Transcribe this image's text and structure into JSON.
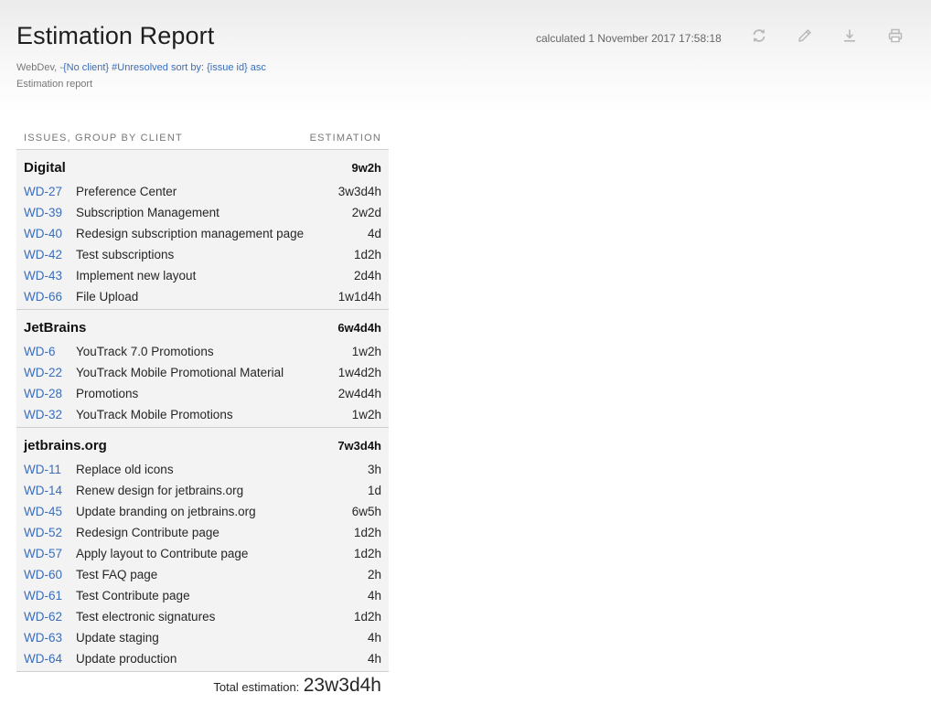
{
  "header": {
    "title": "Estimation Report",
    "calculated": "calculated 1 November 2017 17:58:18",
    "query_prefix": "WebDev, -",
    "query_links": "{No client} #Unresolved sort by: {issue id} asc",
    "subtitle": "Estimation report",
    "icons": [
      "refresh-icon",
      "edit-icon",
      "download-icon",
      "print-icon"
    ]
  },
  "table": {
    "col_issues": "ISSUES, GROUP BY CLIENT",
    "col_estimation": "ESTIMATION",
    "groups": [
      {
        "name": "Digital",
        "total": "9w2h",
        "issues": [
          {
            "id": "WD-27",
            "summary": "Preference Center",
            "estimation": "3w3d4h"
          },
          {
            "id": "WD-39",
            "summary": "Subscription Management",
            "estimation": "2w2d"
          },
          {
            "id": "WD-40",
            "summary": "Redesign subscription management page",
            "estimation": "4d"
          },
          {
            "id": "WD-42",
            "summary": "Test subscriptions",
            "estimation": "1d2h"
          },
          {
            "id": "WD-43",
            "summary": "Implement new layout",
            "estimation": "2d4h"
          },
          {
            "id": "WD-66",
            "summary": "File Upload",
            "estimation": "1w1d4h"
          }
        ]
      },
      {
        "name": "JetBrains",
        "total": "6w4d4h",
        "issues": [
          {
            "id": "WD-6",
            "summary": "YouTrack 7.0 Promotions",
            "estimation": "1w2h"
          },
          {
            "id": "WD-22",
            "summary": "YouTrack Mobile Promotional Material",
            "estimation": "1w4d2h"
          },
          {
            "id": "WD-28",
            "summary": "Promotions",
            "estimation": "2w4d4h"
          },
          {
            "id": "WD-32",
            "summary": "YouTrack Mobile Promotions",
            "estimation": "1w2h"
          }
        ]
      },
      {
        "name": "jetbrains.org",
        "total": "7w3d4h",
        "issues": [
          {
            "id": "WD-11",
            "summary": "Replace old icons",
            "estimation": "3h"
          },
          {
            "id": "WD-14",
            "summary": "Renew design for jetbrains.org",
            "estimation": "1d"
          },
          {
            "id": "WD-45",
            "summary": "Update branding on jetbrains.org",
            "estimation": "6w5h"
          },
          {
            "id": "WD-52",
            "summary": "Redesign Contribute page",
            "estimation": "1d2h"
          },
          {
            "id": "WD-57",
            "summary": "Apply layout to Contribute page",
            "estimation": "1d2h"
          },
          {
            "id": "WD-60",
            "summary": "Test FAQ page",
            "estimation": "2h"
          },
          {
            "id": "WD-61",
            "summary": "Test Contribute page",
            "estimation": "4h"
          },
          {
            "id": "WD-62",
            "summary": "Test electronic signatures",
            "estimation": "1d2h"
          },
          {
            "id": "WD-63",
            "summary": "Update staging",
            "estimation": "4h"
          },
          {
            "id": "WD-64",
            "summary": "Update production",
            "estimation": "4h"
          }
        ]
      }
    ]
  },
  "total": {
    "label": "Total estimation:",
    "value": "23w3d4h"
  }
}
